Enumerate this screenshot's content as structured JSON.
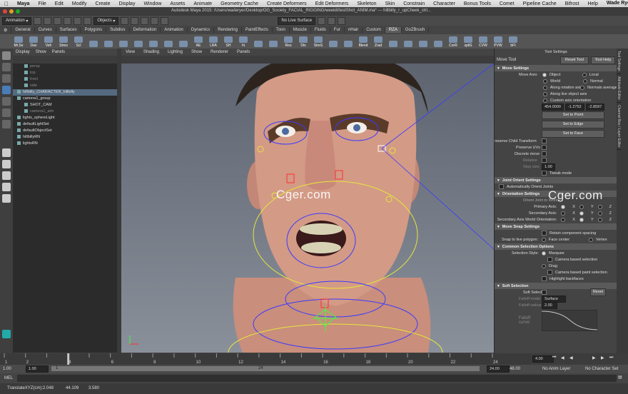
{
  "menubar": {
    "apple": "",
    "app": "Maya",
    "items": [
      "File",
      "Edit",
      "Modify",
      "Create",
      "Display",
      "Window",
      "Assets",
      "Animate",
      "Geometry Cache",
      "Create Deformers",
      "Edit Deformers",
      "Skeleton",
      "Skin",
      "Constrain",
      "Character",
      "Bonus Tools",
      "Comet",
      "Pipeline Cache",
      "Bifrost",
      "Help"
    ],
    "user": "Wade Ryer"
  },
  "window": {
    "title": "Autodesk Maya 2015: /Users/waderyer/Desktop/OG_Society_FACIAL_RIGGING/week8/testShot_ANIM.ma*  ---  hillbilly_r_upCheek_ctrl..."
  },
  "toolrow": {
    "mode": "Animation",
    "objects": "Objects",
    "live": "No Live Surface"
  },
  "shelf": {
    "tabs": [
      "General",
      "Curves",
      "Surfaces",
      "Polygons",
      "Subdivs",
      "Deformation",
      "Animation",
      "Dynamics",
      "Rendering",
      "PaintEffects",
      "Toon",
      "Muscle",
      "Fluids",
      "Fur",
      "nHair",
      "Custom",
      "RZA",
      "GoZBrush"
    ],
    "active": "RZA",
    "icons": [
      "Mr.Se",
      "Dav",
      "Veh",
      "Stres",
      "Scl",
      "",
      "",
      "",
      "",
      "",
      "",
      "",
      "AE",
      "LRA",
      "SH",
      "hi",
      "",
      "",
      "Res",
      "Dis",
      "StreS",
      "",
      "",
      "Blend",
      "Zrad",
      "",
      "",
      "",
      "",
      "CorR",
      "spliS",
      "CVW",
      "PVW",
      "bFt"
    ]
  },
  "outliner": {
    "menus": [
      "Display",
      "Show",
      "Panels"
    ],
    "rows": [
      {
        "t": "persp",
        "d": 1,
        "dim": true
      },
      {
        "t": "top",
        "d": 1,
        "dim": true
      },
      {
        "t": "front",
        "d": 1,
        "dim": true
      },
      {
        "t": "side",
        "d": 1,
        "dim": true
      },
      {
        "t": "hillbilly_CHARACTER_hillbilly",
        "d": 0,
        "sel": true
      },
      {
        "t": "camera1_group",
        "d": 0
      },
      {
        "t": "SHOT_CAM",
        "d": 1
      },
      {
        "t": "camera1_aim",
        "d": 1,
        "dim": true
      },
      {
        "t": "lights_sphereLight",
        "d": 0
      },
      {
        "t": "defaultLightSet",
        "d": 0
      },
      {
        "t": "defaultObjectSet",
        "d": 0
      },
      {
        "t": "hillbillyRN",
        "d": 0
      },
      {
        "t": "lightsRN",
        "d": 0
      }
    ]
  },
  "viewport": {
    "menus": [
      "View",
      "Shading",
      "Lighting",
      "Show",
      "Renderer",
      "Panels"
    ]
  },
  "toolsettings": {
    "title": "Tool Settings",
    "tool": "Move Tool",
    "reset": "Reset Tool",
    "help": "Tool Help",
    "sections": {
      "move": "Move Settings",
      "joint": "Joint Orient Settings",
      "orient": "Orientation Settings",
      "snap": "Move Snap Settings",
      "common": "Common Selection Options",
      "soft": "Soft Selection"
    },
    "moveAxis": "Move Axis:",
    "axisOpts": [
      "Object",
      "Local",
      "World",
      "Normal",
      "Along rotation axis",
      "Normals average",
      "Along live object axis",
      "Custom axis orientation"
    ],
    "coords": [
      "454.0000",
      "-1.2752",
      "-2.8597"
    ],
    "btns": [
      "Set to Point",
      "Set to Edge",
      "Set to Face"
    ],
    "preserve": "reserve Child Transform",
    "uvs": "Preserve UVs",
    "discrete": "Discrete move",
    "relative": "Relative",
    "step": "Step size",
    "stepval": "1.00",
    "tweak": "Tweak mode",
    "autoOrient": "Automatically Orient Joints",
    "orientJoint": "Orient Joint to World",
    "primary": "Primary Axis:",
    "secondary": "Secondary Axis:",
    "secWorld": "Secondary Axis World Orientation:",
    "xyz": [
      "X",
      "Y",
      "Z"
    ],
    "retain": "Retain component spacing",
    "snapLive": "Snap to live polygon:",
    "faceCenter": "Face center",
    "vertex": "Vertex",
    "selStyle": "Selection Style:",
    "marquee": "Marquee",
    "camSel": "Camera based selection",
    "drag": "Drag",
    "camPaint": "Camera based paint selection",
    "highlight": "Highlight backfaces",
    "softSel": "Soft Select:",
    "resetBtn": "Reset",
    "falloffMode": "Falloff mode:",
    "falloffModeVal": "Surface",
    "falloffRadius": "Falloff radius:",
    "falloffRadiusVal": "2.00",
    "falloffCurve": "Falloff curve:"
  },
  "sidetabs": [
    "Tool Settings",
    "Attribute Editor",
    "Channel Box / Layer Editor"
  ],
  "timeline": {
    "ticks": [
      "1",
      "2",
      "4",
      "6",
      "8",
      "10",
      "12",
      "14",
      "16",
      "18",
      "20",
      "22",
      "24"
    ],
    "current": "4.00"
  },
  "range": {
    "start": "1.00",
    "start2": "1.00",
    "mid": "1",
    "mid2": "24",
    "end": "24.00",
    "end2": "48.00",
    "anim": "No Anim Layer",
    "char": "No Character Set"
  },
  "mel": {
    "label": "MEL"
  },
  "help": {
    "text": "TranslateXYZ(cm):",
    "x": "2.048",
    "y": "44.109",
    "z": "3.580"
  },
  "watermark": "Cger.com",
  "colors": {
    "bg": "#444444",
    "outlinerSel": "#546a80",
    "viewportTop": "#5d6470",
    "viewportBottom": "#8a909a"
  }
}
